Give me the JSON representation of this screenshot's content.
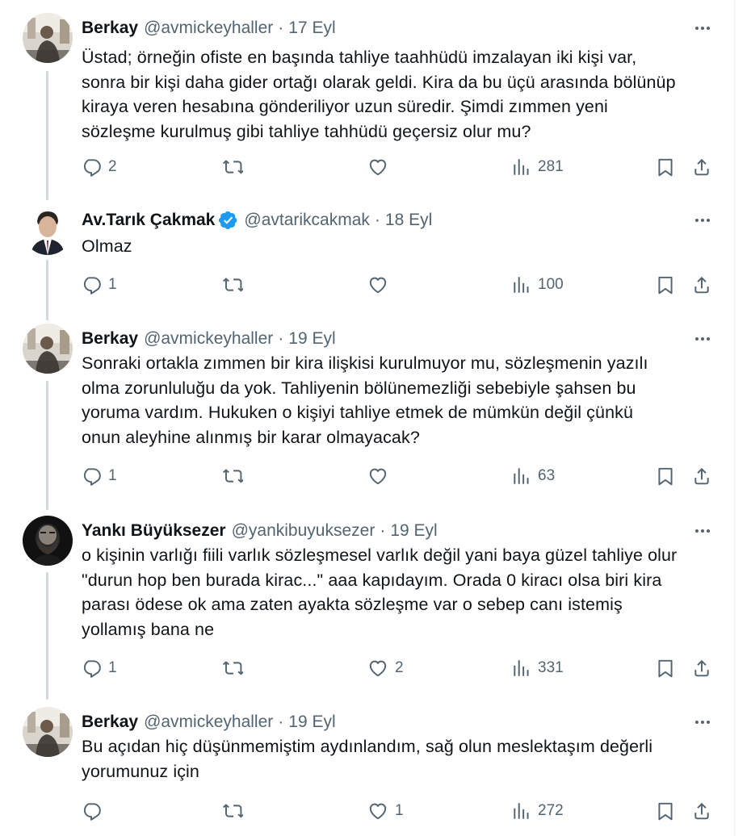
{
  "tweets": [
    {
      "name": "Berkay",
      "handle": "@avmickeyhaller",
      "date": "17 Eyl",
      "verified": false,
      "text_lines": [
        "Üstad; örneğin ofiste en başında tahliye taahhüdü imzalayan iki kişi var,",
        "sonra bir kişi daha gider ortağı olarak geldi. Kira da bu üçü arasında bölünüp",
        "kiraya veren hesabına gönderiliyor uzun süredir. Şimdi zımmen yeni",
        "sözleşme kurulmuş gibi tahliye tahhüdü geçersiz olur mu?"
      ],
      "replies": "2",
      "retweets": "",
      "likes": "",
      "views": "281"
    },
    {
      "name": "Av.Tarık Çakmak",
      "handle": "@avtarikcakmak",
      "date": "18 Eyl",
      "verified": true,
      "text_lines": [
        "Olmaz"
      ],
      "replies": "1",
      "retweets": "",
      "likes": "",
      "views": "100"
    },
    {
      "name": "Berkay",
      "handle": "@avmickeyhaller",
      "date": "19 Eyl",
      "verified": false,
      "text_lines": [
        "Sonraki ortakla zımmen bir kira ilişkisi kurulmuyor mu, sözleşmenin yazılı",
        "olma zorunluluğu da yok. Tahliyenin bölünemezliği sebebiyle şahsen bu",
        "yoruma vardım. Hukuken o kişiyi tahliye etmek de mümkün değil çünkü",
        "onun aleyhine alınmış bir karar olmayacak?"
      ],
      "replies": "1",
      "retweets": "",
      "likes": "",
      "views": "63"
    },
    {
      "name": "Yankı Büyüksezer",
      "handle": "@yankibuyuksezer",
      "date": "19 Eyl",
      "verified": false,
      "text_lines": [
        "o kişinin varlığı fiili varlık sözleşmesel varlık değil yani baya güzel tahliye olur",
        "\"durun hop ben burada kirac...\" aaa kapıdayım. Orada 0 kiracı olsa biri kira",
        "parası ödese ok ama zaten ayakta sözleşme var o sebep canı istemiş",
        "yollamış bana ne"
      ],
      "replies": "1",
      "retweets": "",
      "likes": "2",
      "views": "331"
    },
    {
      "name": "Berkay",
      "handle": "@avmickeyhaller",
      "date": "19 Eyl",
      "verified": false,
      "text_lines": [
        "Bu açıdan hiç düşünmemiştim aydınlandım, sağ olun meslektaşım değerli",
        "yorumunuz için"
      ],
      "replies": "",
      "retweets": "",
      "likes": "1",
      "views": "272"
    }
  ],
  "separator": "·",
  "colors": {
    "text_primary": "#0f1419",
    "text_secondary": "#536471",
    "thread_line": "#cfd9de",
    "verified_badge": "#1d9bf0"
  },
  "icons": [
    "reply-icon",
    "retweet-icon",
    "like-icon",
    "views-icon",
    "bookmark-icon",
    "share-icon",
    "more-icon",
    "verified-badge-icon"
  ]
}
